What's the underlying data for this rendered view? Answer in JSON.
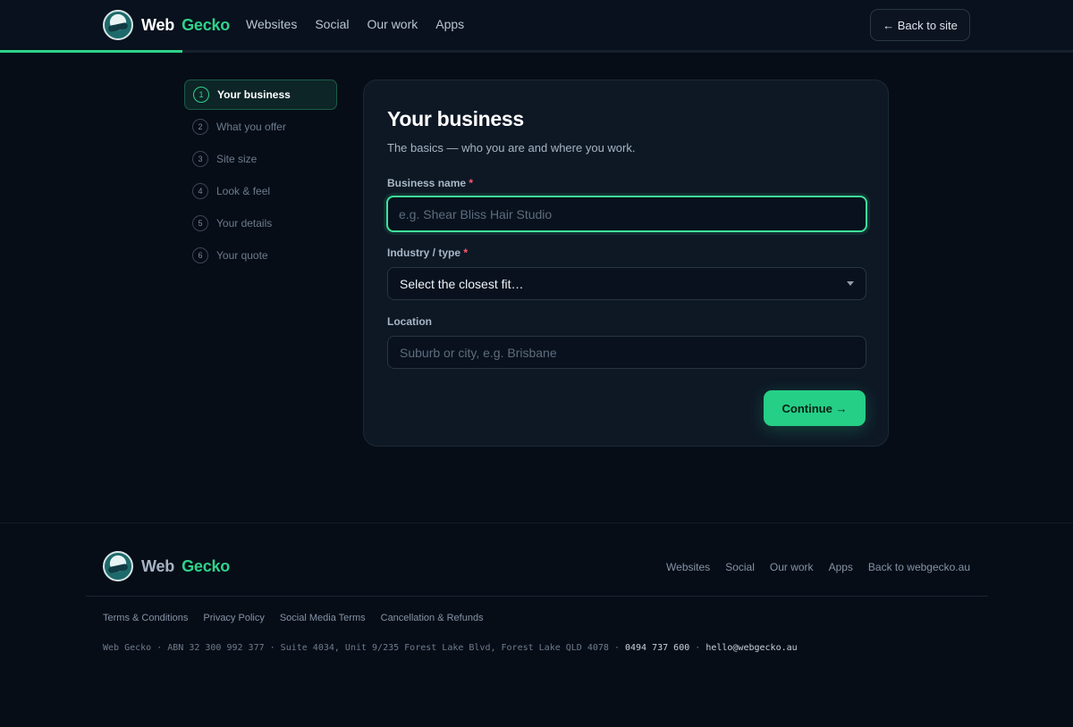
{
  "header": {
    "brand": {
      "first": "Web",
      "second": "Gecko"
    },
    "nav": [
      "Websites",
      "Social",
      "Our work",
      "Apps"
    ],
    "back_label": "← Back to site",
    "progress": 0.17
  },
  "steps": [
    {
      "num": "1",
      "label": "Your business",
      "active": true
    },
    {
      "num": "2",
      "label": "What you offer"
    },
    {
      "num": "3",
      "label": "Site size"
    },
    {
      "num": "4",
      "label": "Look & feel"
    },
    {
      "num": "5",
      "label": "Your details"
    },
    {
      "num": "6",
      "label": "Your quote"
    }
  ],
  "form": {
    "title": "Your business",
    "subtitle": "The basics — who you are and where you work.",
    "business_name": {
      "label": "Business name",
      "required": "*",
      "placeholder": "e.g. Shear Bliss Hair Studio",
      "value": ""
    },
    "industry": {
      "label": "Industry / type",
      "required": "*",
      "selected": "Select the closest fit…"
    },
    "location": {
      "label": "Location",
      "placeholder": "Suburb or city, e.g. Brisbane",
      "value": ""
    },
    "continue_label": "Continue →"
  },
  "footer": {
    "brand": {
      "first": "Web",
      "second": "Gecko"
    },
    "nav": [
      "Websites",
      "Social",
      "Our work",
      "Apps",
      "Back to webgecko.au"
    ],
    "legal": [
      "Terms & Conditions",
      "Privacy Policy",
      "Social Media Terms",
      "Cancellation & Refunds"
    ],
    "info_prefix": "Web Gecko · ABN 32 300 992 377 · Suite 4034, Unit 9/235 Forest Lake Blvd, Forest Lake QLD 4078 · ",
    "phone": "0494 737 600",
    "separator": " · ",
    "email": "hello@webgecko.au"
  },
  "colors": {
    "accent": "#2fd28a",
    "background": "#060d17",
    "card": "#0e1825",
    "required": "#ff5a6e"
  }
}
